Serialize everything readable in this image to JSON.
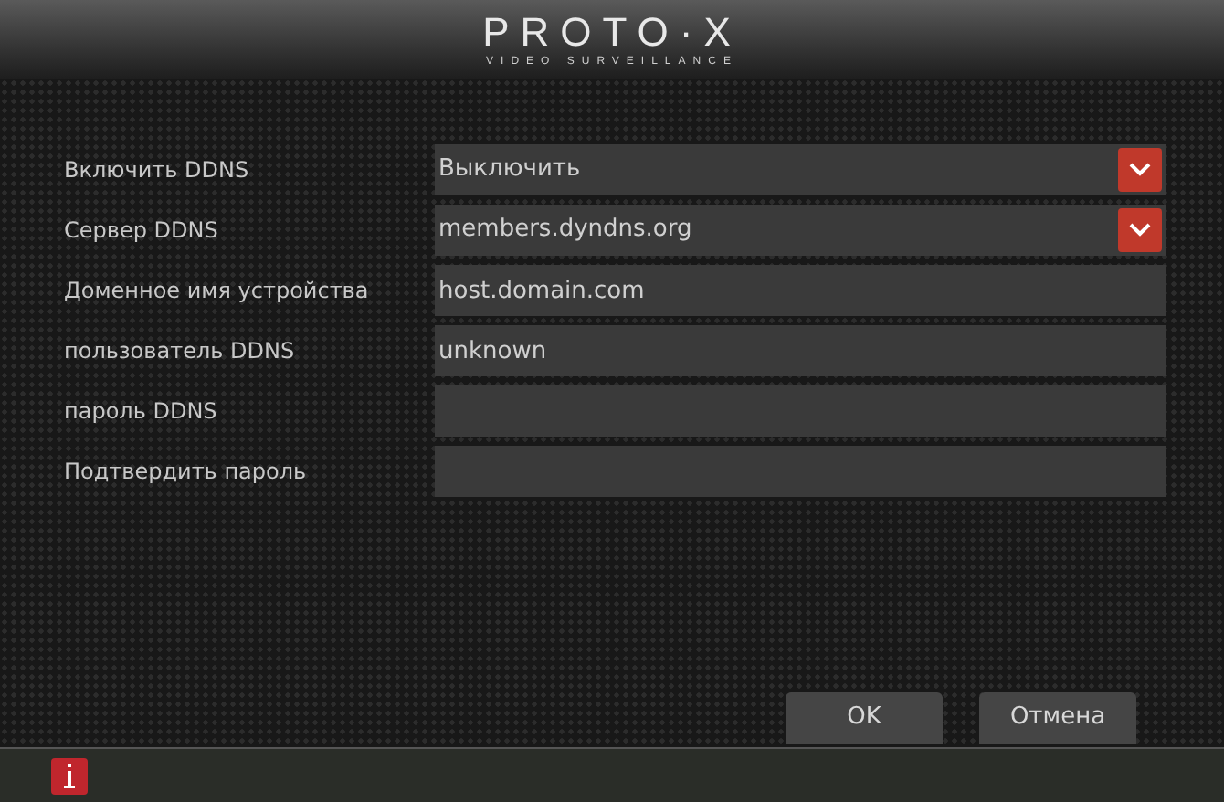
{
  "header": {
    "logo": "PROTO·X",
    "tagline": "VIDEO SURVEILLANCE"
  },
  "fields": [
    {
      "label": "Включить DDNS",
      "kind": "select",
      "value": "Выключить"
    },
    {
      "label": "Сервер DDNS",
      "kind": "select",
      "value": "members.dyndns.org"
    },
    {
      "label": "Доменное имя устройства",
      "kind": "text",
      "value": "host.domain.com"
    },
    {
      "label": "пользователь DDNS",
      "kind": "text",
      "value": "unknown"
    },
    {
      "label": "пароль DDNS",
      "kind": "text"
    },
    {
      "label": "Подтвердить пароль",
      "kind": "text"
    }
  ],
  "buttons": [
    "OK",
    "Отмена"
  ]
}
